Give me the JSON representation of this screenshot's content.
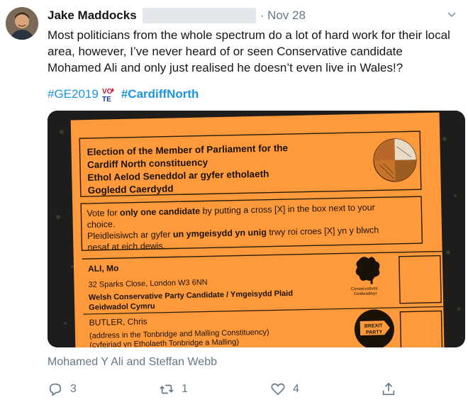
{
  "tweet": {
    "author_name": "Jake Maddocks",
    "date": "· Nov 28",
    "text": "Most politicians from the whole spectrum do a lot of hard work for their local area, however, I’ve never heard of or seen Conservative candidate Mohamed Ali and only just realised he doesn’t even live in Wales!?",
    "hashtag_1": "#GE2019",
    "hashtag_2": "#CardiffNorth",
    "vote_emoji_text": "VOTE",
    "tagged_people": "Mohamed Y Ali and Steffan Webb",
    "reply_count": "3",
    "retweet_count": "1",
    "like_count": "4"
  },
  "ballot": {
    "heading_1": "Election of the Member of Parliament for the",
    "heading_2": "Cardiff North constituency",
    "heading_3": "Ethol Aelod Seneddol ar gyfer etholaeth",
    "heading_4": "Gogledd Caerdydd",
    "instr_1_pre": "Vote for ",
    "instr_1_bold": "only one candidate",
    "instr_1_post": " by putting a cross [X] in the box next to your",
    "instr_2": "choice.",
    "instr_3_pre": "Pleidleisiwch ar gyfer ",
    "instr_3_bold": "un ymgeisydd yn unig",
    "instr_3_post": " trwy roi croes [X] yn y blwch",
    "instr_4": "nesaf at eich dewis.",
    "cand1_name": "ALI, Mo",
    "cand1_address": "32 Sparks Close, London W3 6NN",
    "cand1_desc_1": "Welsh Conservative Party Candidate / Ymgeisydd Plaid",
    "cand1_desc_2": "Geidwadol Cymru",
    "cand1_logo_1": "Conservatives",
    "cand1_logo_2": "Ceidwadwyr",
    "cand2_name": "BUTLER, Chris",
    "cand2_address_1": "(address in the Tonbridge and Malling Constituency)",
    "cand2_address_2": "(cyfeiriad yn Etholaeth Tonbridge a Malling)",
    "cand2_logo_1": "BREXIT",
    "cand2_logo_2": "PARTY"
  },
  "colors": {
    "ballot_orange": "#ff9a3c",
    "link_blue": "#1b95e0",
    "muted_gray": "#657786"
  },
  "icons": [
    "avatar",
    "chevron-down-icon",
    "vote-emoji-icon",
    "reply-icon",
    "retweet-icon",
    "like-icon",
    "share-icon"
  ]
}
